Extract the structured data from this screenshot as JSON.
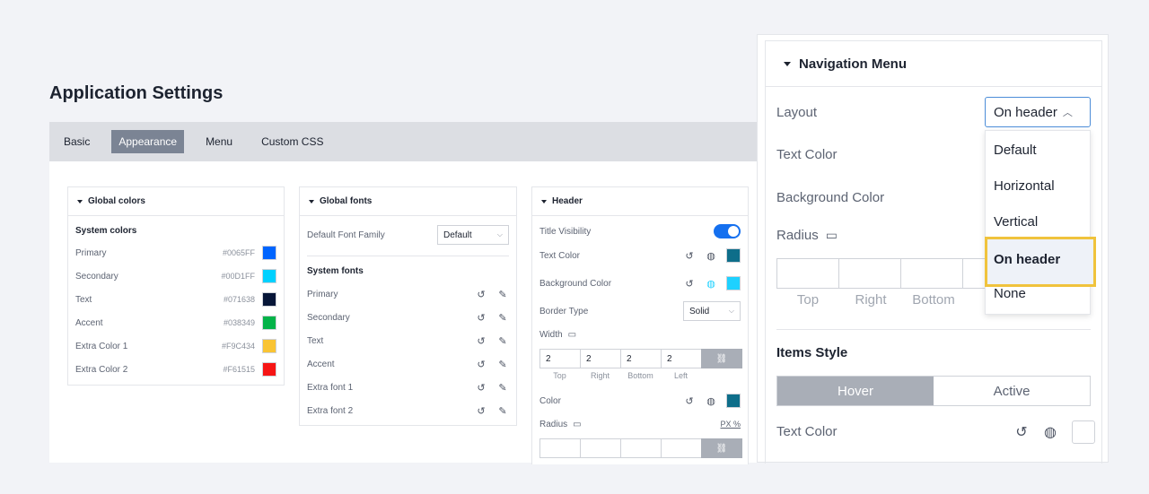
{
  "app": {
    "title": "Application Settings"
  },
  "tabs": [
    {
      "label": "Basic"
    },
    {
      "label": "Appearance",
      "active": true
    },
    {
      "label": "Menu"
    },
    {
      "label": "Custom CSS"
    }
  ],
  "global_colors": {
    "title": "Global colors",
    "subtitle": "System colors",
    "items": [
      {
        "label": "Primary",
        "hex": "#0065FF",
        "color": "#0065FF"
      },
      {
        "label": "Secondary",
        "hex": "#00D1FF",
        "color": "#00D1FF"
      },
      {
        "label": "Text",
        "hex": "#071638",
        "color": "#071638"
      },
      {
        "label": "Accent",
        "hex": "#038349",
        "color": "#03B349"
      },
      {
        "label": "Extra Color 1",
        "hex": "#F9C434",
        "color": "#F9C434"
      },
      {
        "label": "Extra Color 2",
        "hex": "#F61515",
        "color": "#F61515"
      }
    ]
  },
  "global_fonts": {
    "title": "Global fonts",
    "default_label": "Default Font Family",
    "default_value": "Default",
    "subtitle": "System fonts",
    "items": [
      {
        "label": "Primary"
      },
      {
        "label": "Secondary"
      },
      {
        "label": "Text"
      },
      {
        "label": "Accent"
      },
      {
        "label": "Extra font 1"
      },
      {
        "label": "Extra font 2"
      }
    ]
  },
  "header_card": {
    "title": "Header",
    "title_visibility": "Title Visibility",
    "text_color": "Text Color",
    "text_color_value": "#0E6E8A",
    "background_color": "Background Color",
    "background_color_value": "#1ED1FF",
    "border_type": "Border Type",
    "border_type_value": "Solid",
    "width": "Width",
    "width_values": [
      "2",
      "2",
      "2",
      "2"
    ],
    "side_labels": [
      "Top",
      "Right",
      "Bottom",
      "Left"
    ],
    "color": "Color",
    "color_value": "#0E6E8A",
    "radius": "Radius",
    "units": "PX %"
  },
  "nav_panel": {
    "title": "Navigation Menu",
    "layout_label": "Layout",
    "layout_value": "On header",
    "text_color": "Text Color",
    "background_color": "Background Color",
    "radius": "Radius",
    "radius_labels": [
      "Top",
      "Right",
      "Bottom"
    ],
    "dropdown_options": [
      "Default",
      "Horizontal",
      "Vertical",
      "On header",
      "None"
    ],
    "items_style": "Items Style",
    "segments": [
      "Hover",
      "Active"
    ],
    "items_text_color": "Text Color"
  }
}
